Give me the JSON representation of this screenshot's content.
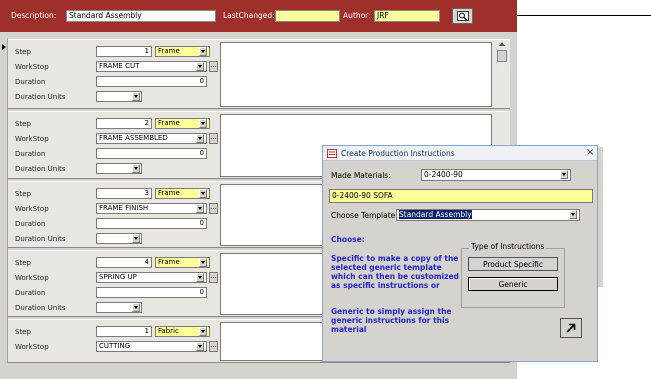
{
  "header": {
    "description_label": "Description:",
    "description_value": "Standard Assembly",
    "last_changed_label": "LastChanged:",
    "last_changed_value": "",
    "author_label": "Author:",
    "author_value": "JRF",
    "search_icon": "magnifier-icon",
    "colors": {
      "band": "#9f2f2a",
      "highlight": "#ffff99"
    }
  },
  "labels": {
    "step": "Step",
    "workstop": "WorkStop",
    "duration": "Duration",
    "duration_units": "Duration Units",
    "ellipsis": "..."
  },
  "records": [
    {
      "step": "1",
      "category": "Frame",
      "workstop": "FRAME CUT",
      "duration": "0",
      "duration_units": ""
    },
    {
      "step": "2",
      "category": "Frame",
      "workstop": "FRAME ASSEMBLED",
      "duration": "0",
      "duration_units": ""
    },
    {
      "step": "3",
      "category": "Frame",
      "workstop": "FRAME FINISH",
      "duration": "0",
      "duration_units": ""
    },
    {
      "step": "4",
      "category": "Frame",
      "workstop": "SPRING UP",
      "duration": "0",
      "duration_units": ""
    },
    {
      "step": "1",
      "category": "Fabric",
      "workstop": "CUTTING",
      "duration": "0",
      "duration_units": ""
    }
  ],
  "dialog": {
    "title": "Create Production Instructions",
    "made_materials_label": "Made Materials:",
    "made_materials_value": "0-2400-90",
    "material_description": "0-2400-90 SOFA",
    "choose_template_label": "Choose Template",
    "choose_template_value": "Standard Assembly",
    "choose_heading": "Choose:",
    "specific_text": "Specific to make a copy of the selected generic template which can then be customized as  specific instructions or",
    "generic_text": "Generic to simply assign the generic instructions for this material",
    "group_title": "Type of Instructions",
    "product_specific_button": "Product Specific",
    "generic_button": "Generic",
    "close_symbol": "×",
    "run_icon": "diagonal-arrow-icon"
  }
}
